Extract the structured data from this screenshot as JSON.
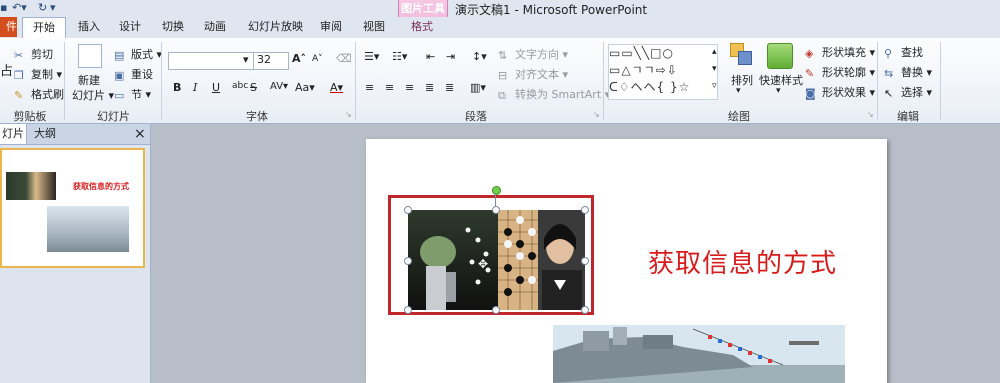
{
  "titlebar": {
    "doc_title": "演示文稿1 - Microsoft PowerPoint",
    "context_tool_title": "图片工具"
  },
  "tabs": {
    "file": "件",
    "home": "开始",
    "insert": "插入",
    "design": "设计",
    "transitions": "切换",
    "animations": "动画",
    "slideshow": "幻灯片放映",
    "review": "审阅",
    "view": "视图",
    "format": "格式"
  },
  "ribbon": {
    "clipboard": {
      "cut": "剪切",
      "copy": "复制",
      "format_painter": "格式刷",
      "label": "剪贴板",
      "paste_partial": "占"
    },
    "slides": {
      "new_slide_1": "新建",
      "new_slide_2": "幻灯片",
      "layout": "版式",
      "reset": "重设",
      "section": "节",
      "label": "幻灯片"
    },
    "font": {
      "size": "32",
      "bold": "B",
      "italic": "I",
      "underline": "U",
      "strike": "S",
      "shadow": "abc",
      "spacing": "AV",
      "case": "Aa",
      "color": "A",
      "grow": "A",
      "shrink": "A",
      "label": "字体"
    },
    "paragraph": {
      "text_direction": "文字方向",
      "align_text": "对齐文本",
      "smartart": "转换为 SmartArt",
      "label": "段落"
    },
    "drawing": {
      "arrange": "排列",
      "quick_styles": "快速样式",
      "shape_fill": "形状填充",
      "shape_outline": "形状轮廓",
      "shape_effects": "形状效果",
      "label": "绘图"
    },
    "editing": {
      "find": "查找",
      "replace": "替换",
      "select": "选择",
      "label": "编辑"
    }
  },
  "leftpanel": {
    "tab_slides": "灯片",
    "tab_outline": "大纲",
    "close": "×",
    "thumb_title": "获取信息的方式"
  },
  "slide": {
    "title": "获取信息的方式"
  },
  "colors": {
    "file_tab": "#d34e1c",
    "title_red": "#d81c1c",
    "selection_border": "#c0272d",
    "context_pink": "#f7c6e3"
  }
}
